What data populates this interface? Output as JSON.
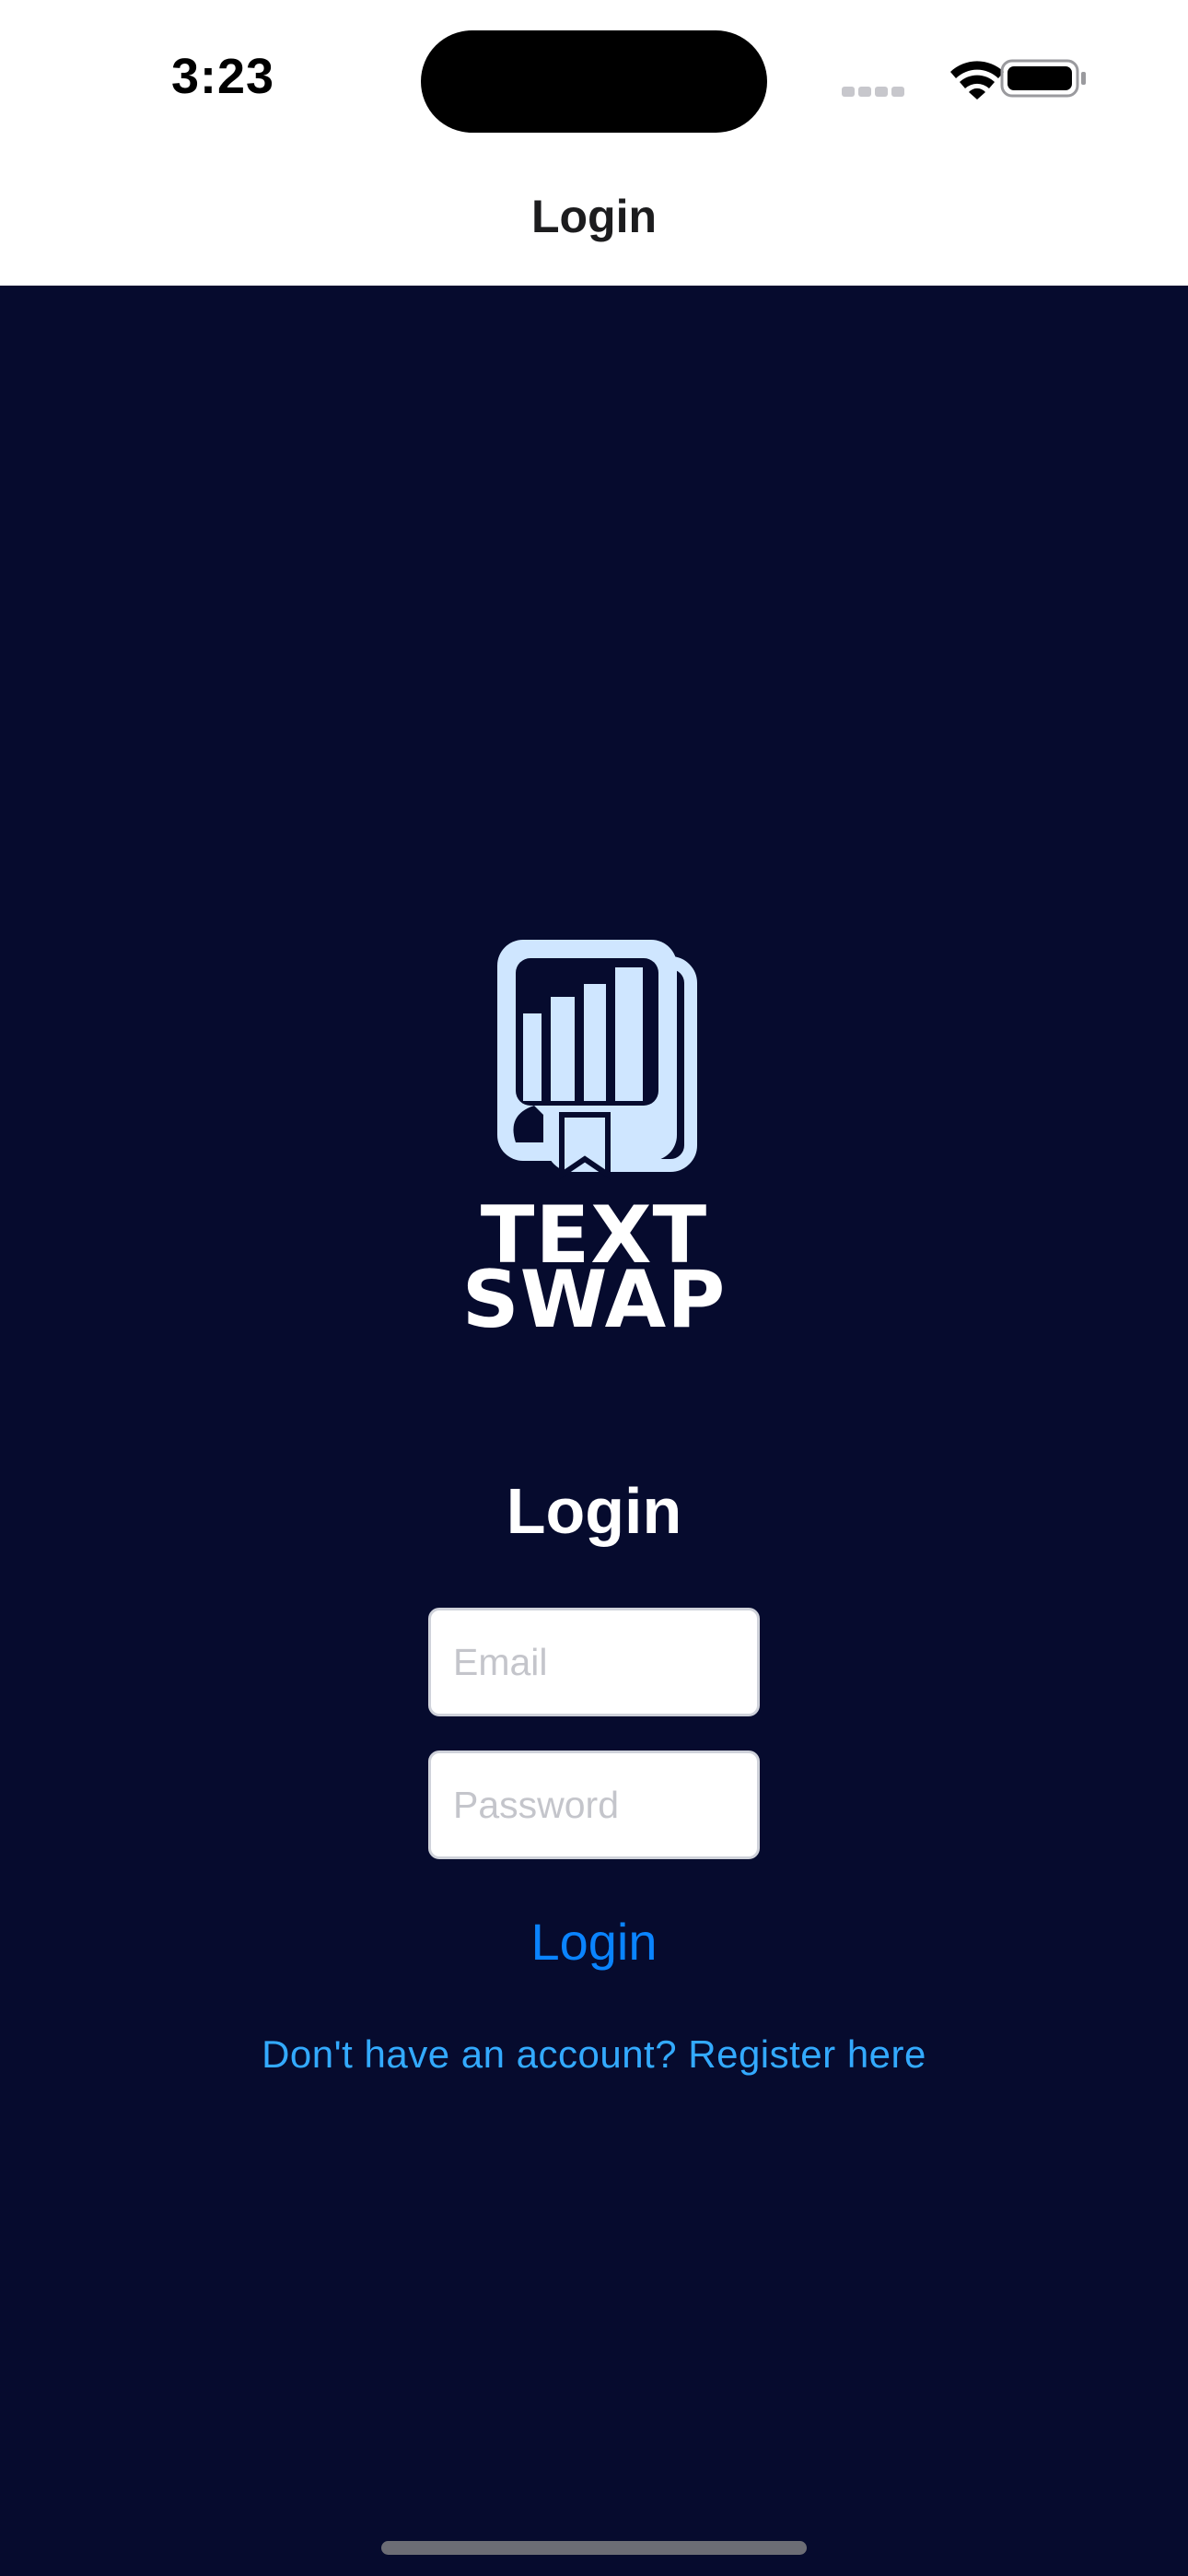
{
  "status_bar": {
    "time": "3:23",
    "icons": [
      "signal-dots-icon",
      "wifi-icon",
      "battery-icon"
    ]
  },
  "nav_bar": {
    "title": "Login"
  },
  "logo": {
    "line1": "TEXT",
    "line2": "SWAP",
    "icon": "book-logo-icon",
    "color": "#cfe6ff"
  },
  "form": {
    "heading": "Login",
    "email_placeholder": "Email",
    "email_value": "",
    "password_placeholder": "Password",
    "password_value": "",
    "login_label": "Login",
    "register_text": "Don't have an account? Register here"
  },
  "colors": {
    "background": "#060b2e",
    "accent": "#0a84ff",
    "link": "#33aaff"
  }
}
